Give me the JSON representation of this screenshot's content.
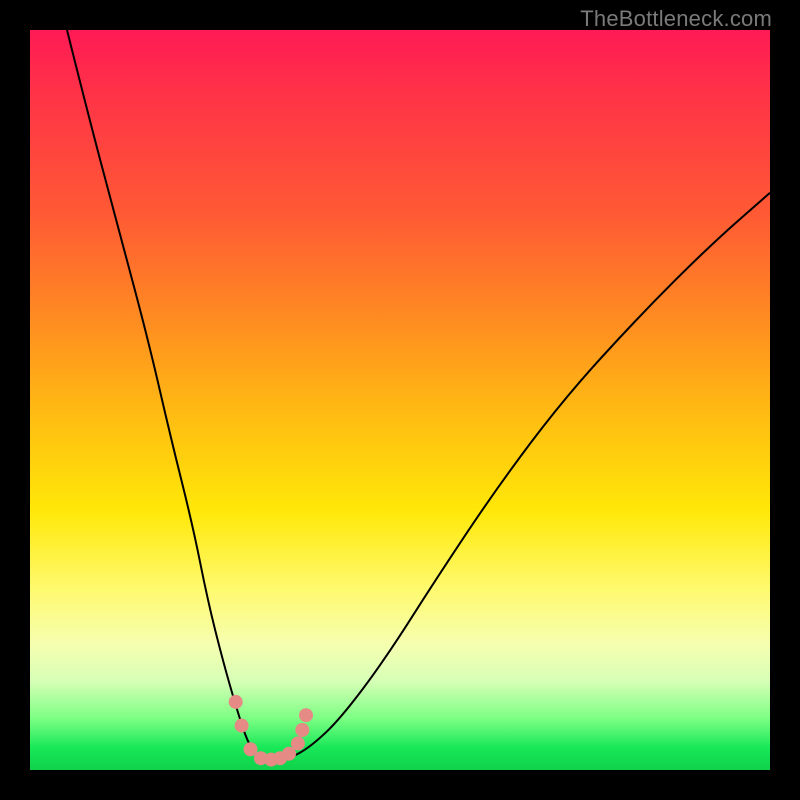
{
  "watermark": "TheBottleneck.com",
  "colors": {
    "frame": "#000000",
    "gradient_top": "#ff1a55",
    "gradient_mid": "#ffe808",
    "gradient_bottom": "#0fd24a",
    "curve": "#000000",
    "marker": "#e58a85"
  },
  "chart_data": {
    "type": "line",
    "title": "",
    "xlabel": "",
    "ylabel": "",
    "xlim": [
      0,
      100
    ],
    "ylim": [
      0,
      100
    ],
    "grid": false,
    "note": "Axis tick labels are not rendered in the screenshot; x/y values below are estimated on a 0–100 normalized scale where x increases left→right and y increases bottom→top.",
    "series": [
      {
        "name": "bottleneck-curve",
        "x": [
          5,
          8,
          12,
          16,
          19,
          22,
          24,
          26,
          28,
          29.5,
          31,
          33,
          35,
          38,
          42,
          48,
          55,
          63,
          72,
          82,
          92,
          100
        ],
        "y": [
          100,
          88,
          73,
          58,
          45,
          33,
          23,
          15,
          8,
          3.5,
          1.5,
          1.2,
          1.5,
          3.2,
          7,
          15,
          26,
          38,
          50,
          61,
          71,
          78
        ]
      }
    ],
    "markers": {
      "name": "salmon-dots",
      "x": [
        27.8,
        28.6,
        29.8,
        31.2,
        32.6,
        33.8,
        35.0,
        36.2,
        36.8,
        37.3
      ],
      "y": [
        9.2,
        6.0,
        2.8,
        1.6,
        1.4,
        1.6,
        2.2,
        3.6,
        5.4,
        7.4
      ]
    }
  }
}
